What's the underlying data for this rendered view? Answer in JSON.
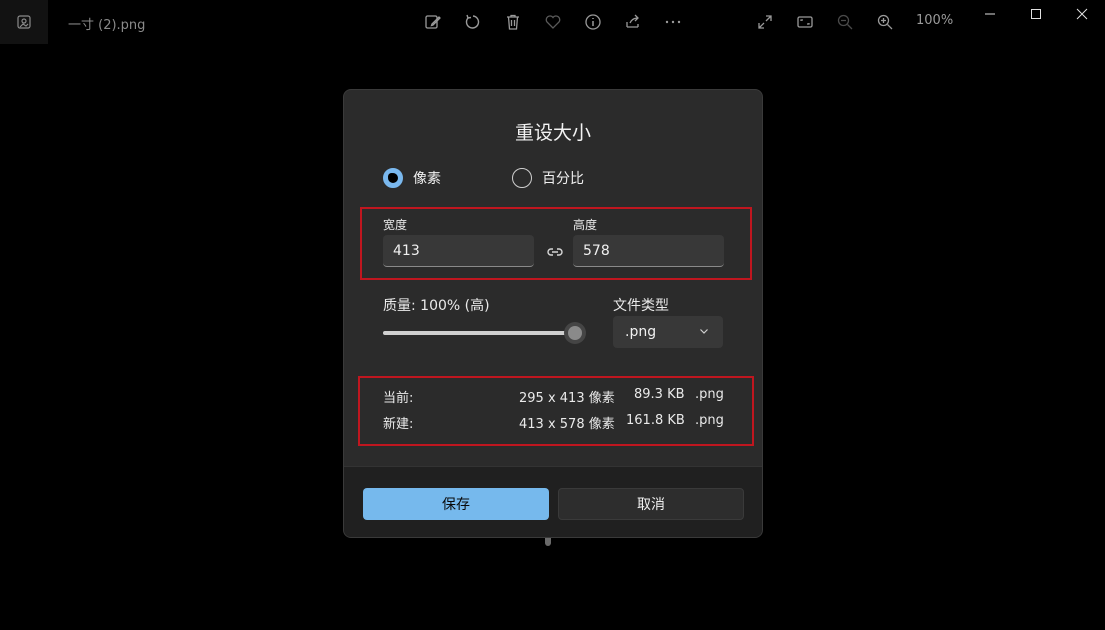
{
  "window": {
    "file_title": "一寸 (2).png",
    "zoom_level": "100%"
  },
  "toolbar": {
    "icons": [
      "edit-icon",
      "rotate-icon",
      "delete-icon",
      "favorite-icon",
      "info-icon",
      "share-icon",
      "more-icon",
      "fullscreen-icon",
      "fit-icon",
      "zoom-out-icon",
      "zoom-in-icon"
    ]
  },
  "dialog": {
    "title": "重设大小",
    "mode_pixels_label": "像素",
    "mode_percent_label": "百分比",
    "width_label": "宽度",
    "width_value": "413",
    "height_label": "高度",
    "height_value": "578",
    "quality_label": "质量: 100% (高)",
    "quality_level": 1.0,
    "filetype_label": "文件类型",
    "filetype_value": ".png",
    "current": {
      "label": "当前:",
      "dimensions": "295 x 413 像素",
      "size": "89.3 KB",
      "ext": ".png"
    },
    "new": {
      "label": "新建:",
      "dimensions": "413 x 578 像素",
      "size": "161.8 KB",
      "ext": ".png"
    },
    "save_label": "保存",
    "cancel_label": "取消"
  },
  "colors": {
    "accent": "#76b9ed",
    "highlight": "#c0161f",
    "dialog_bg": "#2b2b2b"
  }
}
